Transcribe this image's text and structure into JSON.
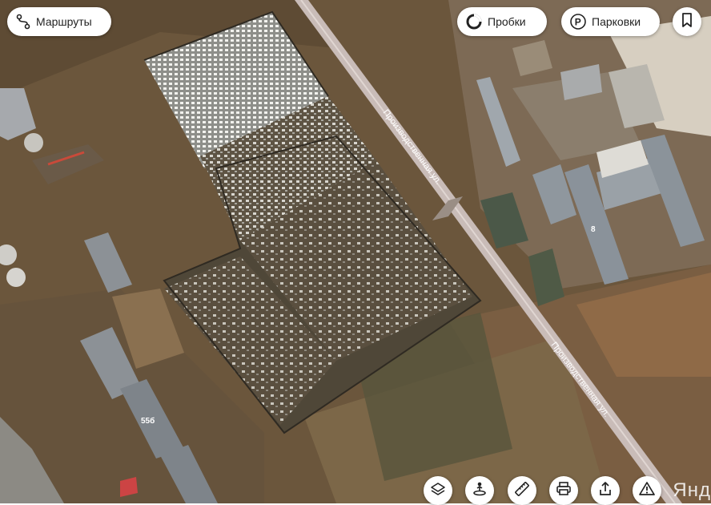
{
  "top_bar": {
    "routes_label": "Маршруты",
    "traffic_label": "Пробки",
    "parking_label": "Парковки"
  },
  "map": {
    "road_name": "Производственная ул.",
    "building_numbers": [
      "55б",
      "8"
    ],
    "watermark": "Янд"
  },
  "icons": {
    "routes": "routes-icon",
    "traffic": "traffic-icon",
    "parking": "parking-icon",
    "bookmark": "bookmark-icon",
    "layers": "layers-icon",
    "panorama": "panorama-icon",
    "ruler": "ruler-icon",
    "print": "print-icon",
    "share": "share-icon",
    "report": "warning-icon"
  },
  "colors": {
    "button_bg": "#ffffff",
    "road": "#c9bcb8",
    "ground": "#6e5a3f"
  }
}
